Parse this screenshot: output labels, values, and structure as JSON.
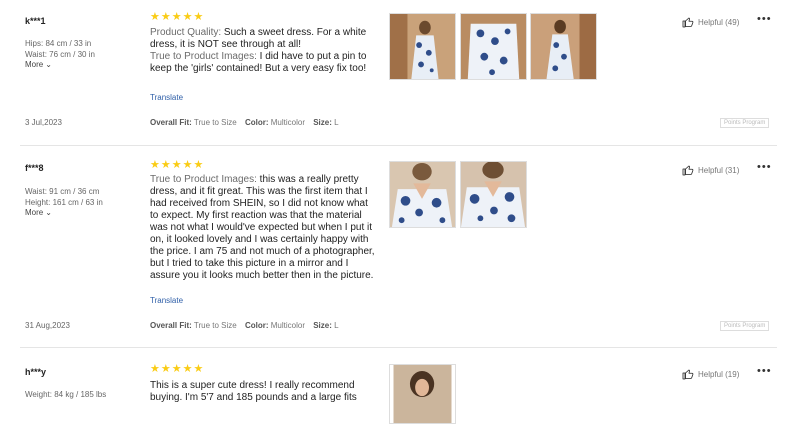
{
  "reviews": [
    {
      "user": "k***1",
      "measures": [
        "Hips: 84 cm / 33 in",
        "Waist: 76 cm / 30 in"
      ],
      "more": "More",
      "date": "3 Jul,2023",
      "stars": "★★★★★",
      "paragraphs": [
        {
          "label": "Product Quality:",
          "text": " Such a sweet dress. For a white dress, it is NOT see through at all!"
        },
        {
          "label": "True to Product Images:",
          "text": " I did have to put a pin to keep the 'girls' contained! But a very easy fix too!"
        }
      ],
      "translate": "Translate",
      "fit": {
        "fit_label": "Overall Fit:",
        "fit_value": "True to Size",
        "color_label": "Color:",
        "color_value": "Multicolor",
        "size_label": "Size:",
        "size_value": "L"
      },
      "helpful": "Helpful (49)",
      "points": "Points Program",
      "photos": 3
    },
    {
      "user": "f***8",
      "measures": [
        "Waist: 91 cm / 36 cm",
        "Height: 161 cm / 63 in"
      ],
      "more": "More",
      "date": "31 Aug,2023",
      "stars": "★★★★★",
      "paragraphs": [
        {
          "label": "True to Product Images:",
          "text": " this was a really pretty dress, and it fit great. This was the first item that I had received from SHEIN, so I did not know what to expect. My first reaction was that the material was not what I would've expected but when I put it on, it looked lovely and I was certainly happy with the price. I am 75 and not much of a photographer, but I tried to take this picture in a mirror and I assure you it looks much better then in the picture."
        }
      ],
      "translate": "Translate",
      "fit": {
        "fit_label": "Overall Fit:",
        "fit_value": "True to Size",
        "color_label": "Color:",
        "color_value": "Multicolor",
        "size_label": "Size:",
        "size_value": "L"
      },
      "helpful": "Helpful (31)",
      "points": "Points Program",
      "photos": 2
    },
    {
      "user": "h***y",
      "measures": [
        "Weight: 84 kg / 185 lbs"
      ],
      "stars": "★★★★★",
      "paragraphs": [
        {
          "label": "",
          "text": "This is a super cute dress! I really recommend buying. I'm 5'7 and 185 pounds and a large fits"
        }
      ],
      "helpful": "Helpful (19)",
      "photos": 1
    }
  ],
  "colors": {
    "star": "#facc15",
    "link": "#2f5fa8",
    "divider": "#e5e5e5"
  },
  "icons": {
    "helpful": "thumbs-up-icon",
    "more": "more-dots-icon",
    "expand": "chevron-down-icon"
  }
}
